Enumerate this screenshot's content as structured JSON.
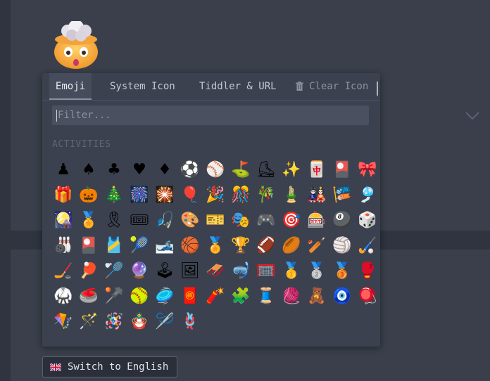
{
  "tabs": [
    {
      "label": "Emoji",
      "active": true
    },
    {
      "label": "System Icon",
      "active": false
    },
    {
      "label": "Tiddler & URL",
      "active": false
    },
    {
      "label": "Clear Icon",
      "active": false
    }
  ],
  "filter": {
    "placeholder": "Filter...",
    "value": ""
  },
  "section_label": "ACTIVITIES",
  "emojis": [
    "♟",
    "♠",
    "♣",
    "♥",
    "♦",
    "⚽",
    "⚾",
    "⛳",
    "⛸",
    "✨",
    "🀄",
    "🎴",
    "🎀",
    "🎁",
    "🎃",
    "🎄",
    "🎆",
    "🎇",
    "🎈",
    "🎉",
    "🎊",
    "🎋",
    "🎍",
    "🎎",
    "🎏",
    "🎐",
    "🎑",
    "🏅",
    "🎗",
    "🎟",
    "🎣",
    "🎨",
    "🎫",
    "🎭",
    "🎮",
    "🎯",
    "🎰",
    "🎱",
    "🎲",
    "🎳",
    "🎴",
    "🎽",
    "🎾",
    "🎿",
    "🏀",
    "🏅",
    "🏆",
    "🏈",
    "🏉",
    "🏏",
    "🏐",
    "🏑",
    "🏒",
    "🏓",
    "🏸",
    "🔮",
    "🕹",
    "🖼",
    "🛷",
    "🤿",
    "🥅",
    "🥇",
    "🥈",
    "🥉",
    "🥊",
    "🥋",
    "🥌",
    "🥍",
    "🥎",
    "🥏",
    "🧧",
    "🧨",
    "🧩",
    "🧵",
    "🧶",
    "🧸",
    "🧿",
    "🪀",
    "🪁",
    "🪄",
    "🪅",
    "🪆",
    "🪡",
    "🪢"
  ],
  "language_button": {
    "label": "Switch to English",
    "flag": "uk-flag"
  },
  "colors": {
    "background": "#2f343f",
    "card": "#3a3f4b",
    "popup": "#3c4150"
  }
}
